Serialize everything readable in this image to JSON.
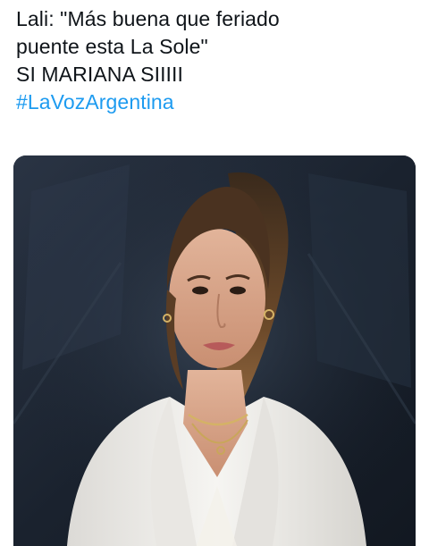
{
  "tweet": {
    "lines": [
      "Lali: \"Más buena que feriado",
      "puente esta La Sole\"",
      "SI MARIANA SIIIII"
    ],
    "hashtag": "#LaVozArgentina"
  },
  "media": {
    "description": "",
    "colors": {
      "background": "#1b2330",
      "jacket": "#f1f0ee",
      "hair": "#7a5530",
      "skin": "#d9a88c"
    }
  }
}
